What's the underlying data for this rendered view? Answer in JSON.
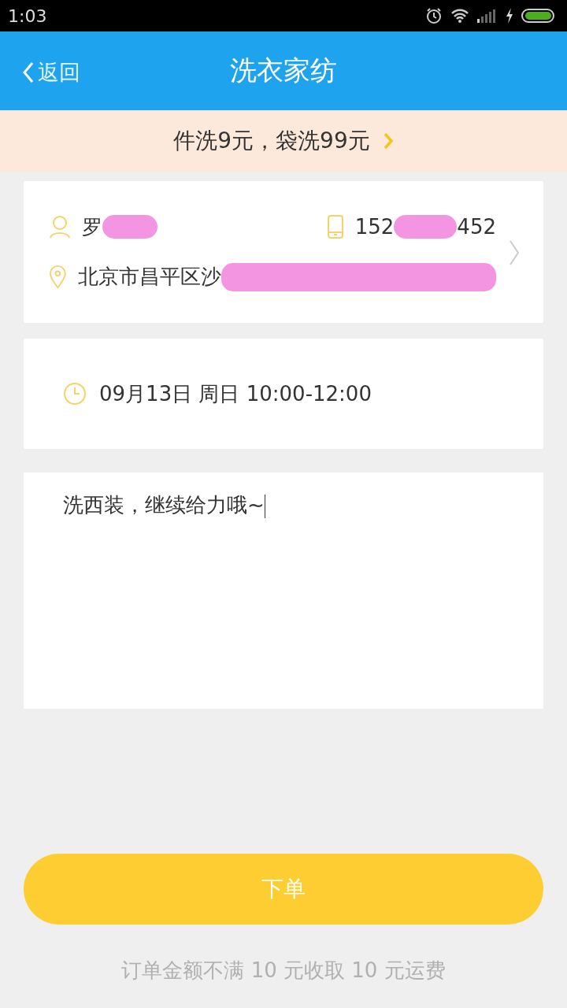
{
  "status_bar": {
    "time": "1:03"
  },
  "header": {
    "back": "返回",
    "title": "洗衣家纺"
  },
  "promo": {
    "text": "件洗9元，袋洗99元"
  },
  "contact": {
    "name": "罗",
    "phone_start": "152",
    "phone_end": "452",
    "address": "北京市昌平区沙"
  },
  "pickup": {
    "time": "09月13日  周日  10:00-12:00"
  },
  "note": {
    "value": "洗西装，继续给力哦~"
  },
  "submit": {
    "label": "下单"
  },
  "footer": {
    "text": "订单金额不满 10 元收取 10 元运费"
  }
}
